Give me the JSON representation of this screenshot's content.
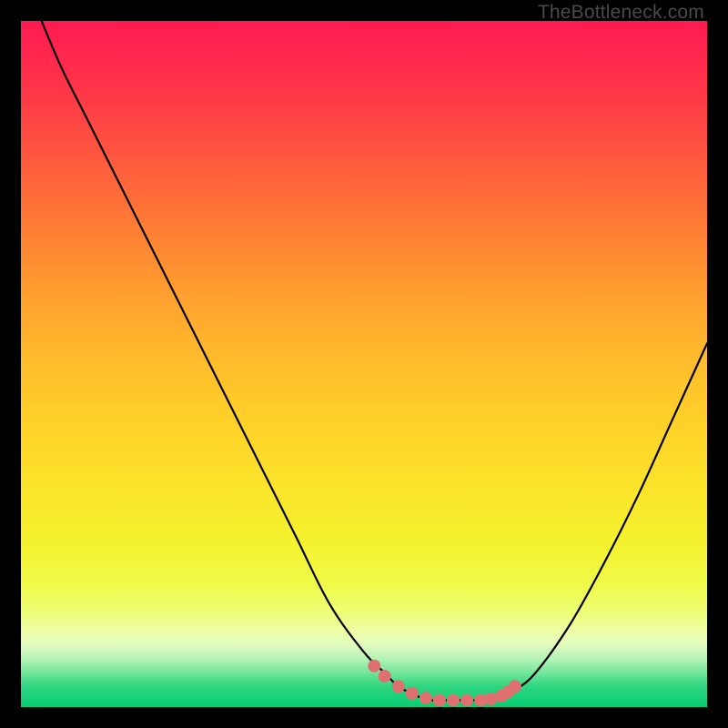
{
  "attribution": "TheBottleneck.com",
  "colors": {
    "page_bg": "#000000",
    "curve_stroke": "#000000",
    "marker_fill": "#e07070",
    "marker_stroke": "#c85a5a"
  },
  "chart_data": {
    "type": "line",
    "title": "",
    "xlabel": "",
    "ylabel": "",
    "xlim": [
      0,
      100
    ],
    "ylim": [
      0,
      100
    ],
    "grid": false,
    "series": [
      {
        "name": "bottleneck-curve",
        "x": [
          3,
          6,
          10,
          15,
          20,
          25,
          30,
          35,
          40,
          45,
          50,
          53,
          55,
          57,
          58,
          60,
          62,
          64,
          66,
          68,
          70,
          72,
          75,
          80,
          85,
          90,
          95,
          100
        ],
        "values": [
          100,
          93,
          85,
          75,
          65,
          55,
          45,
          35,
          25,
          15,
          8,
          5,
          3,
          2,
          1.5,
          1,
          1,
          1,
          1,
          1,
          1.5,
          2.5,
          5,
          12,
          21,
          31,
          42,
          53
        ]
      }
    ],
    "markers": {
      "name": "highlight-dots",
      "x": [
        51.5,
        53,
        55,
        57,
        59,
        61,
        63,
        65,
        67,
        68.5,
        70,
        71,
        72
      ],
      "values": [
        6,
        4.5,
        3,
        2,
        1.3,
        1,
        1,
        1,
        1,
        1.2,
        1.6,
        2.2,
        3
      ]
    }
  }
}
